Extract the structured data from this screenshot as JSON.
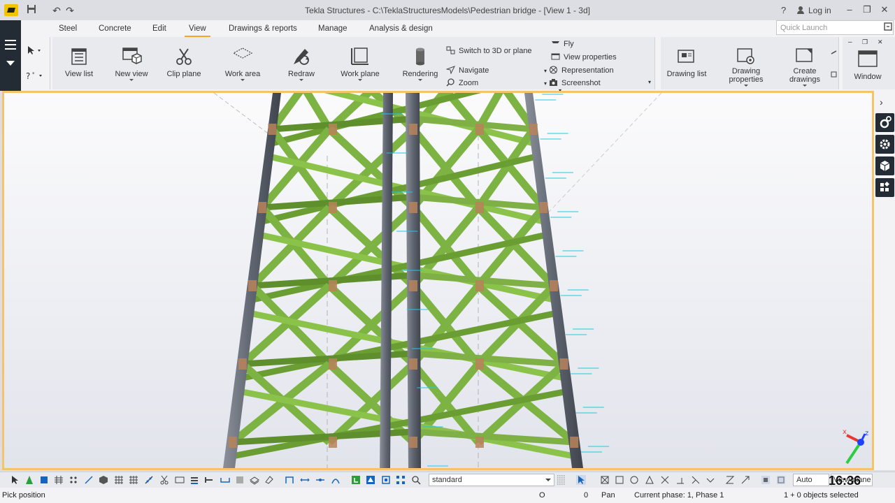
{
  "window": {
    "title": "Tekla Structures - C:\\TeklaStructuresModels\\Pedestrian bridge  - [View 1 - 3d]",
    "help": "?",
    "login": "Log in"
  },
  "menu": {
    "tabs": [
      "Steel",
      "Concrete",
      "Edit",
      "View",
      "Drawings & reports",
      "Manage",
      "Analysis & design"
    ],
    "active_tab": "View",
    "quick_launch_placeholder": "Quick Launch"
  },
  "ribbon": {
    "view_list": "View list",
    "new_view": "New view",
    "clip_plane": "Clip plane",
    "work_area": "Work area",
    "redraw": "Redraw",
    "work_plane": "Work plane",
    "rendering": "Rendering",
    "switch_3d": "Switch to 3D or plane",
    "navigate": "Navigate",
    "zoom": "Zoom",
    "fly": "Fly",
    "view_properties": "View properties",
    "representation": "Representation",
    "screenshot": "Screenshot",
    "drawing_list": "Drawing list",
    "drawing_properties_1": "Drawing",
    "drawing_properties_2": "properties",
    "create_drawings_1": "Create",
    "create_drawings_2": "drawings",
    "window": "Window"
  },
  "bottom_toolbar": {
    "filter": "standard",
    "snap_mode": "Auto",
    "plane": "View plane"
  },
  "clock": "16:36",
  "status": {
    "message": "Pick position",
    "coord_o": "O",
    "coord_zero": "0",
    "mode": "Pan",
    "phase": "Current phase: 1, Phase 1",
    "selection": "1 + 0 objects selected"
  },
  "colors": {
    "accent": "#f5a623",
    "viewport_border": "#f5c46a",
    "bracing_green": "#7cb342",
    "column_gray": "#5f6570",
    "dark_panel": "#232b35"
  }
}
